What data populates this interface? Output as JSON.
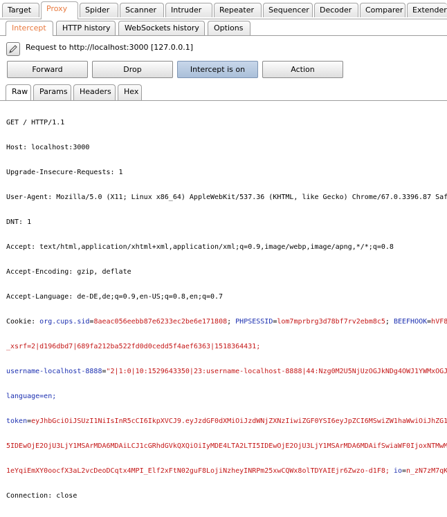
{
  "main_tabs": [
    "Target",
    "Proxy",
    "Spider",
    "Scanner",
    "Intruder",
    "Repeater",
    "Sequencer",
    "Decoder",
    "Comparer",
    "Extender"
  ],
  "proxy_tabs": [
    "Intercept",
    "HTTP history",
    "WebSockets history",
    "Options"
  ],
  "request_label": "Request to http://localhost:3000  [127.0.0.1]",
  "buttons": {
    "forward": "Forward",
    "drop": "Drop",
    "intercept": "Intercept is on",
    "action": "Action"
  },
  "view_tabs": [
    "Raw",
    "Params",
    "Headers",
    "Hex"
  ],
  "request": {
    "line1": "GET / HTTP/1.1",
    "line2": "Host: localhost:3000",
    "line3": "Upgrade-Insecure-Requests: 1",
    "line4": "User-Agent: Mozilla/5.0 (X11; Linux x86_64) AppleWebKit/537.36 (KHTML, like Gecko) Chrome/67.0.3396.87 Saf",
    "line5": "DNT: 1",
    "line6": "Accept: text/html,application/xhtml+xml,application/xml;q=0.9,image/webp,image/apng,*/*;q=0.8",
    "line7": "Accept-Encoding: gzip, deflate",
    "line8": "Accept-Language: de-DE,de;q=0.9,en-US;q=0.8,en;q=0.7",
    "cookie_prefix": "Cookie: ",
    "cookie_1_name": "org.cups.sid",
    "cookie_1_val": "8aeac056eebb87e6233ec2be6e171808",
    "cookie_2_name": "PHPSESSID",
    "cookie_2_val": "lom7mprbrg3d78bf7rv2ebm8c5",
    "cookie_3_name": "BEEFHOOK",
    "cookie_3_val": "hVF8",
    "line10": "_xsrf=2|d196dbd7|689fa212ba522fd0d0cedd5f4aef6363|1518364431;",
    "cookie_4_name": "username-localhost-8888",
    "cookie_4_val": "\"2|1:0|10:1529643350|23:username-localhost-8888|44:Nzg0M2U5NjUzOGJkNDg4OWJ1YWMxOGJ",
    "line12": "language=en;",
    "cookie_5_name": "token",
    "cookie_5_val": "eyJhbGciOiJSUzI1NiIsInR5cCI6IkpXVCJ9.eyJzdGF0dXMiOiJzdWNjZXNzIiwiZGF0YSI6eyJpZCI6MSwiZW1haWwiOiJhZG1",
    "line14": "5IDEwOjE2OjU3LjY1MSArMDA6MDAiLCJ1cGRhdGVkQXQiOiIyMDE4LTA2LTI5IDEwOjE2OjU3LjY1MSArMDA6MDAifSwiaWF0IjoxNTMwM",
    "line15a": "1eYqiEmXY0oocfX3aL2vcDeoDCqtx4MPI_Elf2xFtN02guF8LojiNzheyINRPm25xwCQWx8olTDYAIEjr6Zwzo-d1F8; ",
    "cookie_6_name": "io",
    "cookie_6_val": "n_zN7zM7qK",
    "line16": "Connection: close"
  }
}
